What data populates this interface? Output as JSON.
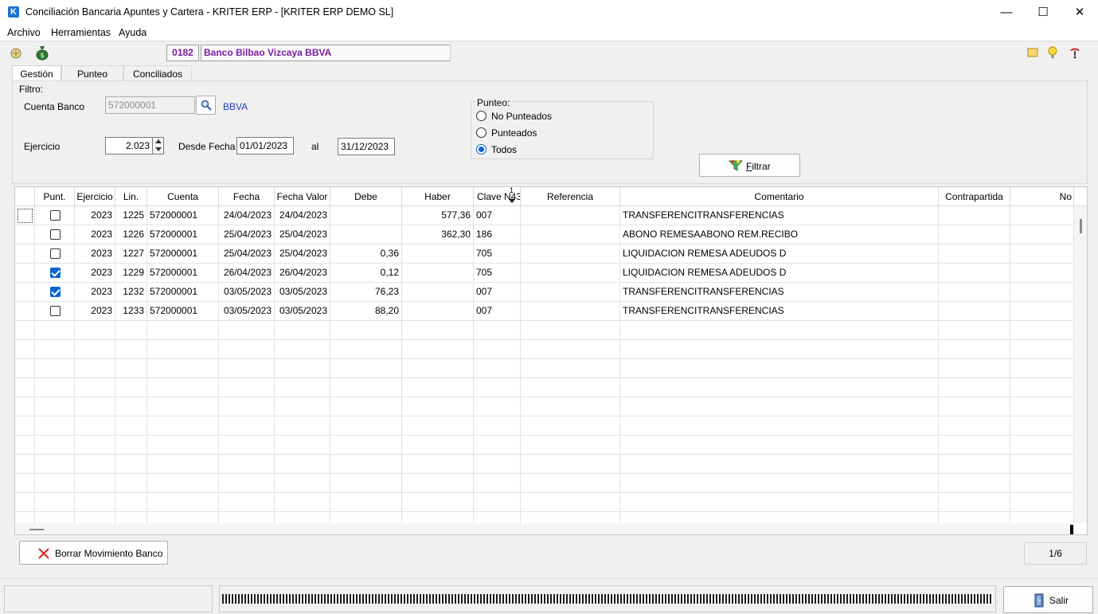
{
  "window": {
    "app_icon": "K",
    "title": "Conciliación Bancaria Apuntes y Cartera - KRITER ERP - [KRITER ERP DEMO SL]",
    "controls": {
      "minimize": "—",
      "maximize": "☐",
      "close": "✕"
    }
  },
  "menu": {
    "items": [
      "Archivo",
      "Herramientas",
      "Ayuda"
    ]
  },
  "toolbar": {
    "bank_code": "0182",
    "bank_name": "Banco Bilbao Vizcaya BBVA",
    "icons": [
      "folder-open-icon",
      "money-bag-icon",
      "note-icon",
      "lightbulb-icon",
      "help-icon"
    ]
  },
  "tabs": [
    {
      "label": "Gestión",
      "active": true
    },
    {
      "label": "Punteo",
      "active": false
    },
    {
      "label": "Conciliados",
      "active": false
    }
  ],
  "filter": {
    "group_label": "Filtro:",
    "cuenta_label": "Cuenta Banco",
    "cuenta_value": "572000001",
    "cuenta_name": "BBVA",
    "ejercicio_label": "Ejercicio",
    "ejercicio_value": "2.023",
    "desde_label": "Desde Fecha",
    "desde_value": "01/01/2023",
    "al_label": "al",
    "hasta_value": "31/12/2023",
    "punteo_label": "Punteo:",
    "punteo_options": [
      "No Punteados",
      "Punteados",
      "Todos"
    ],
    "punteo_selected": "Todos",
    "filtrar_label": "Filtrar",
    "filtrar_mnemonic": "F",
    "filtrar_rest": "iltrar"
  },
  "grid": {
    "columns": [
      "",
      "Punt.",
      "Ejercicio",
      "Lin.",
      "Cuenta",
      "Fecha",
      "Fecha Valor",
      "Debe",
      "Haber",
      "Clave N43",
      "Referencia",
      "Comentario",
      "Contrapartida",
      "No"
    ],
    "sort_indicator": "1",
    "rows": [
      {
        "punt": false,
        "ejercicio": "2023",
        "lin": "1225",
        "cuenta": "572000001",
        "fecha": "24/04/2023",
        "fecha_valor": "24/04/2023",
        "debe": "",
        "haber": "577,36",
        "clave": "007",
        "referencia": "",
        "comentario": "TRANSFERENCITRANSFERENCIAS",
        "contrapartida": ""
      },
      {
        "punt": false,
        "ejercicio": "2023",
        "lin": "1226",
        "cuenta": "572000001",
        "fecha": "25/04/2023",
        "fecha_valor": "25/04/2023",
        "debe": "",
        "haber": "362,30",
        "clave": "186",
        "referencia": "",
        "comentario": "ABONO REMESAABONO REM.RECIBO",
        "contrapartida": ""
      },
      {
        "punt": false,
        "ejercicio": "2023",
        "lin": "1227",
        "cuenta": "572000001",
        "fecha": "25/04/2023",
        "fecha_valor": "25/04/2023",
        "debe": "0,36",
        "haber": "",
        "clave": "705",
        "referencia": "",
        "comentario": "LIQUIDACION REMESA ADEUDOS D",
        "contrapartida": ""
      },
      {
        "punt": true,
        "ejercicio": "2023",
        "lin": "1229",
        "cuenta": "572000001",
        "fecha": "26/04/2023",
        "fecha_valor": "26/04/2023",
        "debe": "0,12",
        "haber": "",
        "clave": "705",
        "referencia": "",
        "comentario": "LIQUIDACION REMESA ADEUDOS D",
        "contrapartida": ""
      },
      {
        "punt": true,
        "ejercicio": "2023",
        "lin": "1232",
        "cuenta": "572000001",
        "fecha": "03/05/2023",
        "fecha_valor": "03/05/2023",
        "debe": "76,23",
        "haber": "",
        "clave": "007",
        "referencia": "",
        "comentario": "TRANSFERENCITRANSFERENCIAS",
        "contrapartida": ""
      },
      {
        "punt": false,
        "ejercicio": "2023",
        "lin": "1233",
        "cuenta": "572000001",
        "fecha": "03/05/2023",
        "fecha_valor": "03/05/2023",
        "debe": "88,20",
        "haber": "",
        "clave": "007",
        "referencia": "",
        "comentario": "TRANSFERENCITRANSFERENCIAS",
        "contrapartida": ""
      }
    ]
  },
  "footer": {
    "borrar_label": "Borrar Movimiento Banco",
    "record_counter": "1/6",
    "salir_label": "Salir"
  },
  "colors": {
    "accent": "#0a64d8",
    "bank_text": "#7a1fa2",
    "cuenta_name": "#1f3fbf",
    "delete_icon": "#d9261c"
  }
}
